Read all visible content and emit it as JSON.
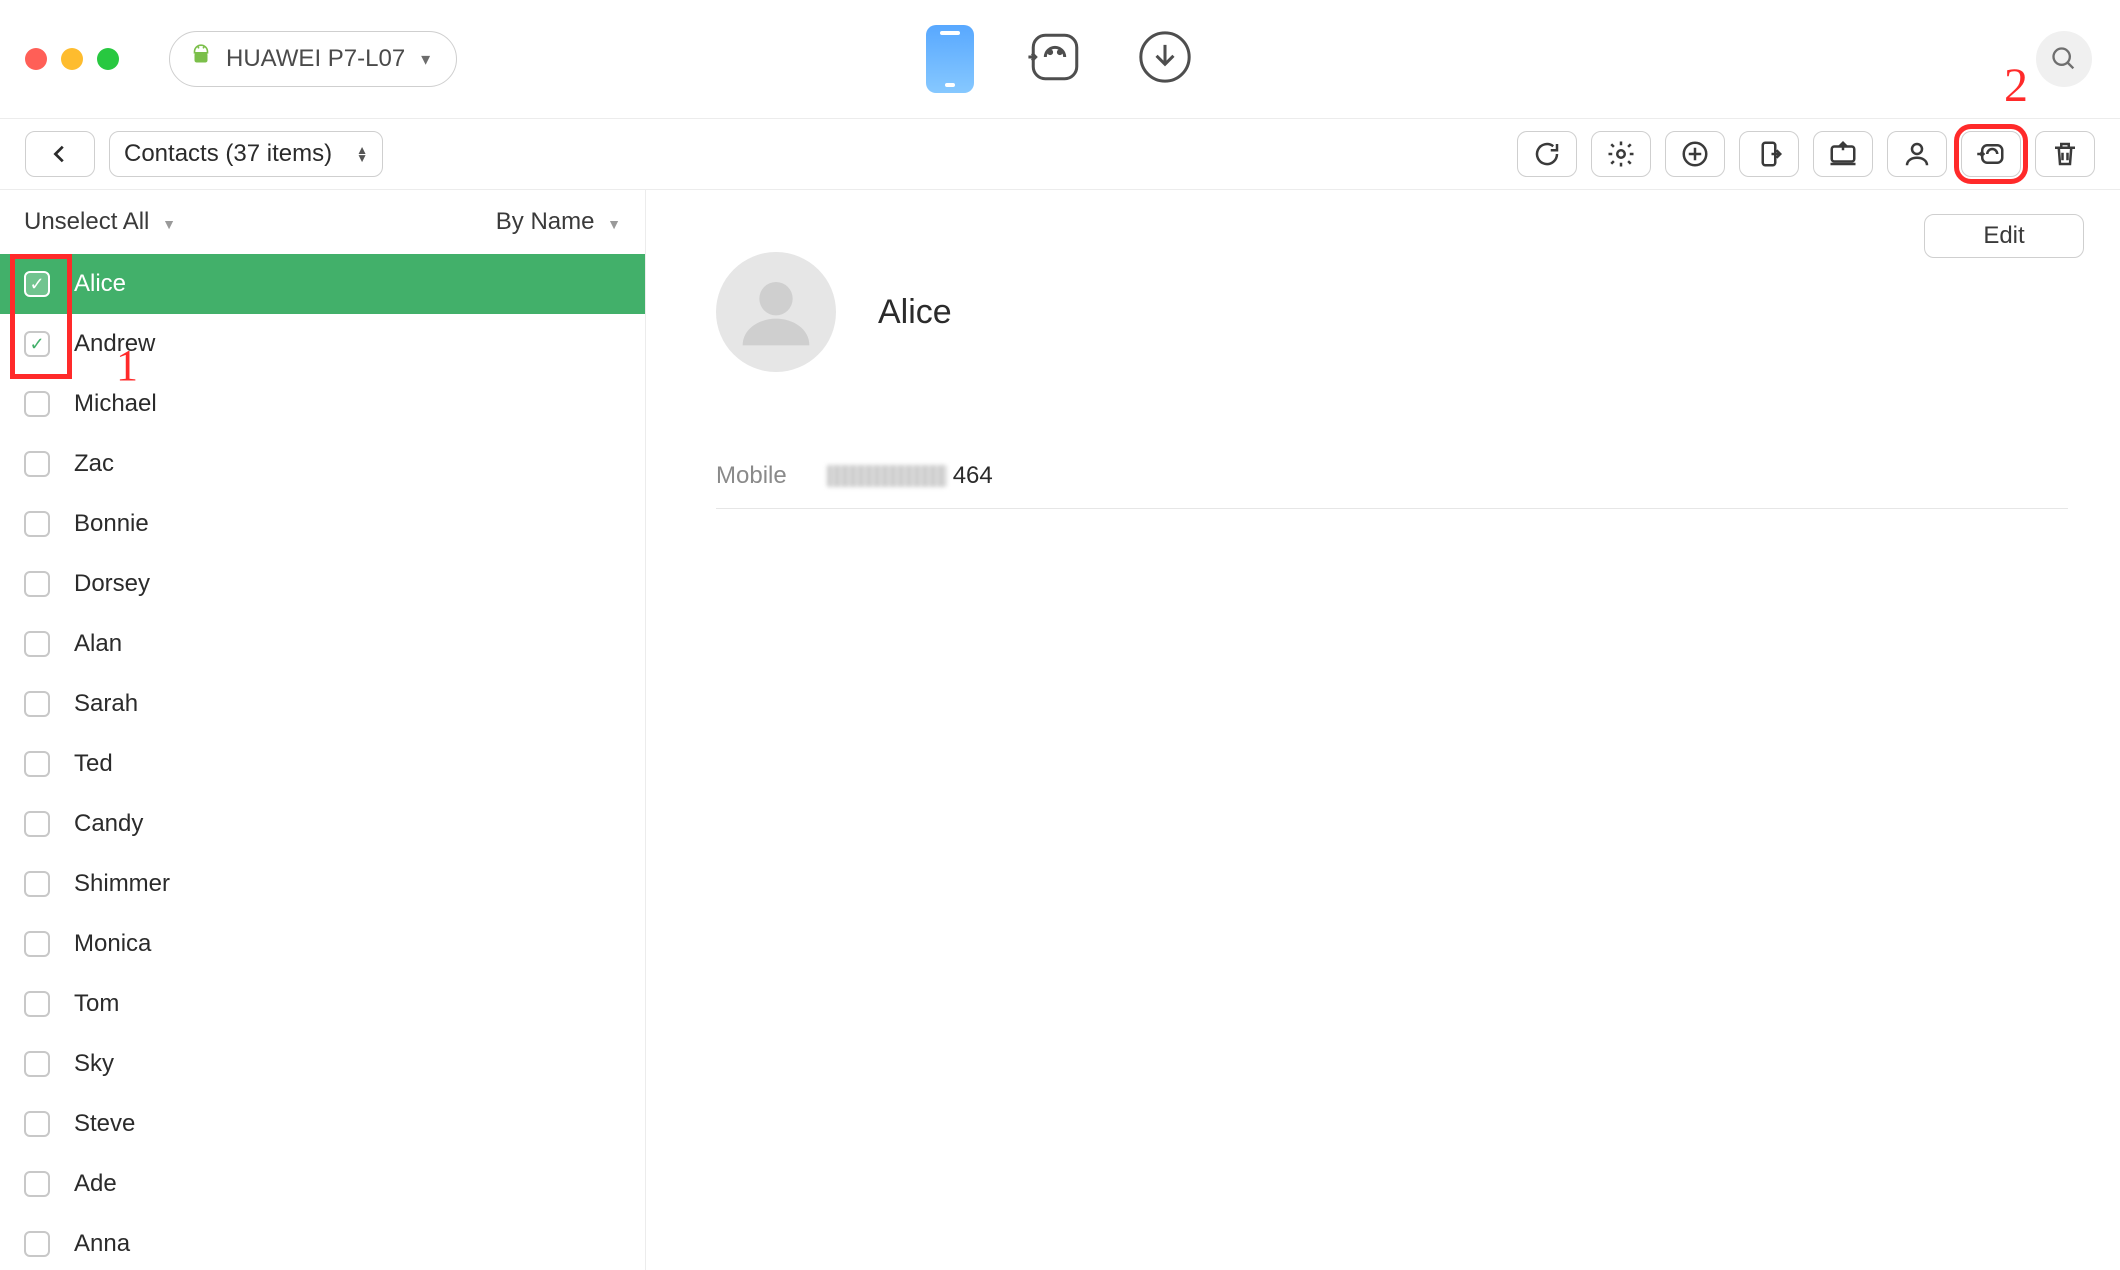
{
  "header": {
    "device_label": "HUAWEI P7-L07"
  },
  "subbar": {
    "category_label": "Contacts (37 items)"
  },
  "list": {
    "unselect_label": "Unselect All",
    "sort_label": "By Name",
    "contacts": [
      {
        "name": "Alice",
        "checked": true,
        "selected": true
      },
      {
        "name": "Andrew",
        "checked": true,
        "selected": false
      },
      {
        "name": "Michael",
        "checked": false,
        "selected": false
      },
      {
        "name": "Zac",
        "checked": false,
        "selected": false
      },
      {
        "name": "Bonnie",
        "checked": false,
        "selected": false
      },
      {
        "name": "Dorsey",
        "checked": false,
        "selected": false
      },
      {
        "name": "Alan",
        "checked": false,
        "selected": false
      },
      {
        "name": "Sarah",
        "checked": false,
        "selected": false
      },
      {
        "name": "Ted",
        "checked": false,
        "selected": false
      },
      {
        "name": "Candy",
        "checked": false,
        "selected": false
      },
      {
        "name": "Shimmer",
        "checked": false,
        "selected": false
      },
      {
        "name": "Monica",
        "checked": false,
        "selected": false
      },
      {
        "name": "Tom",
        "checked": false,
        "selected": false
      },
      {
        "name": "Sky",
        "checked": false,
        "selected": false
      },
      {
        "name": "Steve",
        "checked": false,
        "selected": false
      },
      {
        "name": "Ade",
        "checked": false,
        "selected": false
      },
      {
        "name": "Anna",
        "checked": false,
        "selected": false
      }
    ]
  },
  "detail": {
    "edit_label": "Edit",
    "name": "Alice",
    "mobile_label": "Mobile",
    "mobile_visible_suffix": "464"
  },
  "annotations": {
    "step1": "1",
    "step2": "2"
  }
}
